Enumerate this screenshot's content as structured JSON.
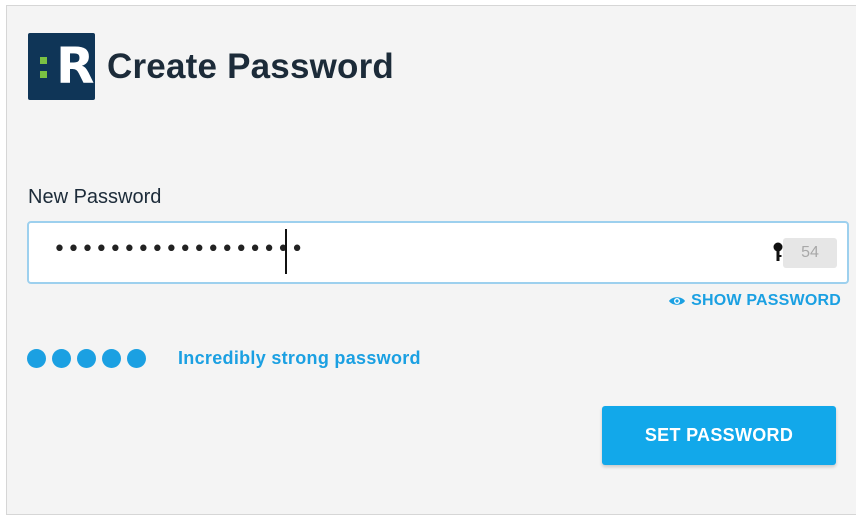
{
  "header": {
    "logo_letter": "R",
    "title": "Create Password"
  },
  "form": {
    "field_label": "New Password",
    "password_masked": "••••••••••••••••••",
    "password_manager_badge": "54",
    "show_password_label": "SHOW PASSWORD"
  },
  "strength": {
    "level": 5,
    "max": 5,
    "label": "Incredibly strong password"
  },
  "actions": {
    "submit_label": "SET PASSWORD"
  },
  "colors": {
    "accent": "#1ba0e2",
    "logo_bg": "#0f3557",
    "logo_dots": "#7ac143",
    "button_bg": "#12a8ea"
  },
  "icons": {
    "logo": "resolver-logo",
    "show_password": "eye-icon",
    "password_manager": "key-icon"
  }
}
